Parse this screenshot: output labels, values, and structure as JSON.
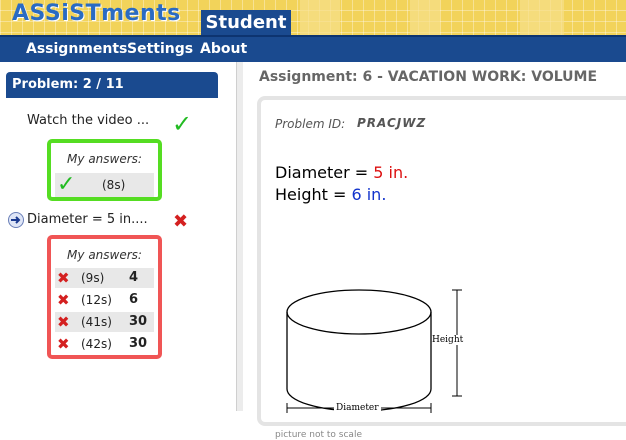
{
  "header": {
    "logo_text": "ASSiSTments",
    "role_tab": "Student"
  },
  "nav": {
    "items": [
      "Assignments",
      "Settings",
      "About"
    ]
  },
  "left": {
    "problem_header": "Problem: 2 / 11",
    "items": [
      {
        "title": "Watch the video ...",
        "status": "correct",
        "answers_label": "My answers:",
        "answers": [
          {
            "mark": "check-icon",
            "time": "(8s)",
            "value": ""
          }
        ]
      },
      {
        "title": "Diameter = 5 in....",
        "status": "incorrect",
        "answers_label": "My answers:",
        "answers": [
          {
            "mark": "x-icon",
            "time": "(9s)",
            "value": "4"
          },
          {
            "mark": "x-icon",
            "time": "(12s)",
            "value": "6"
          },
          {
            "mark": "x-icon",
            "time": "(41s)",
            "value": "30"
          },
          {
            "mark": "x-icon",
            "time": "(42s)",
            "value": "30"
          }
        ]
      }
    ]
  },
  "main": {
    "assignment_title": "Assignment: 6 - VACATION WORK: VOLUME",
    "problem_id_label": "Problem ID:",
    "problem_id": "PRACJWZ",
    "diameter_label": "Diameter = ",
    "diameter_value": "5 in.",
    "height_label": "Height = ",
    "height_value": "6 in.",
    "figure_height_label": "Height",
    "figure_diameter_label": "Diameter",
    "caption": "picture not to scale"
  },
  "colors": {
    "brand_blue": "#1a4a8f",
    "header_yellow": "#f2d35a",
    "correct_green": "#55dd22",
    "incorrect_red": "#f05555",
    "diameter_red": "#dd1111",
    "height_blue": "#1133cc"
  }
}
